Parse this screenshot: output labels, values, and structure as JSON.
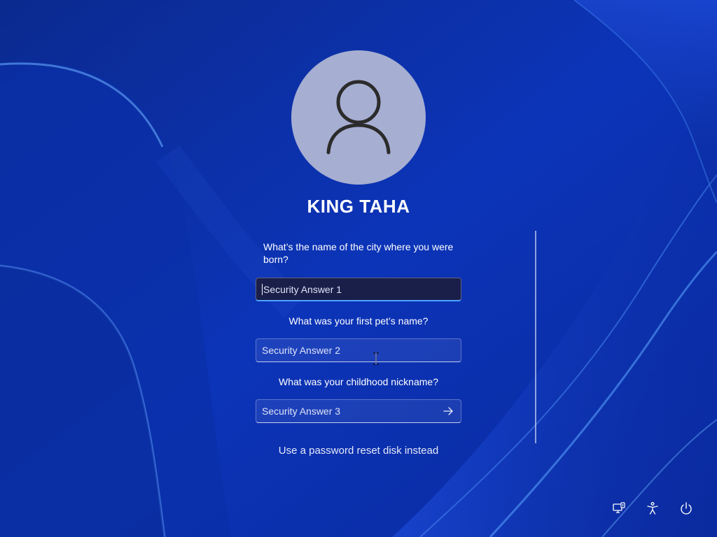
{
  "user": {
    "name": "KING TAHA"
  },
  "security": {
    "questions": [
      {
        "question": "What’s the name of the city where you were born?",
        "placeholder": "Security Answer 1"
      },
      {
        "question": "What was your first pet’s name?",
        "placeholder": "Security Answer 2"
      },
      {
        "question": "What was your childhood nickname?",
        "placeholder": "Security Answer 3"
      }
    ]
  },
  "reset_link": "Use a password reset disk instead",
  "corner_icons": [
    "network-icon",
    "accessibility-icon",
    "power-icon"
  ],
  "colors": {
    "background": "#0a2a9c",
    "avatar": "#a6aed2",
    "focus_accent": "#4fa3ff"
  }
}
